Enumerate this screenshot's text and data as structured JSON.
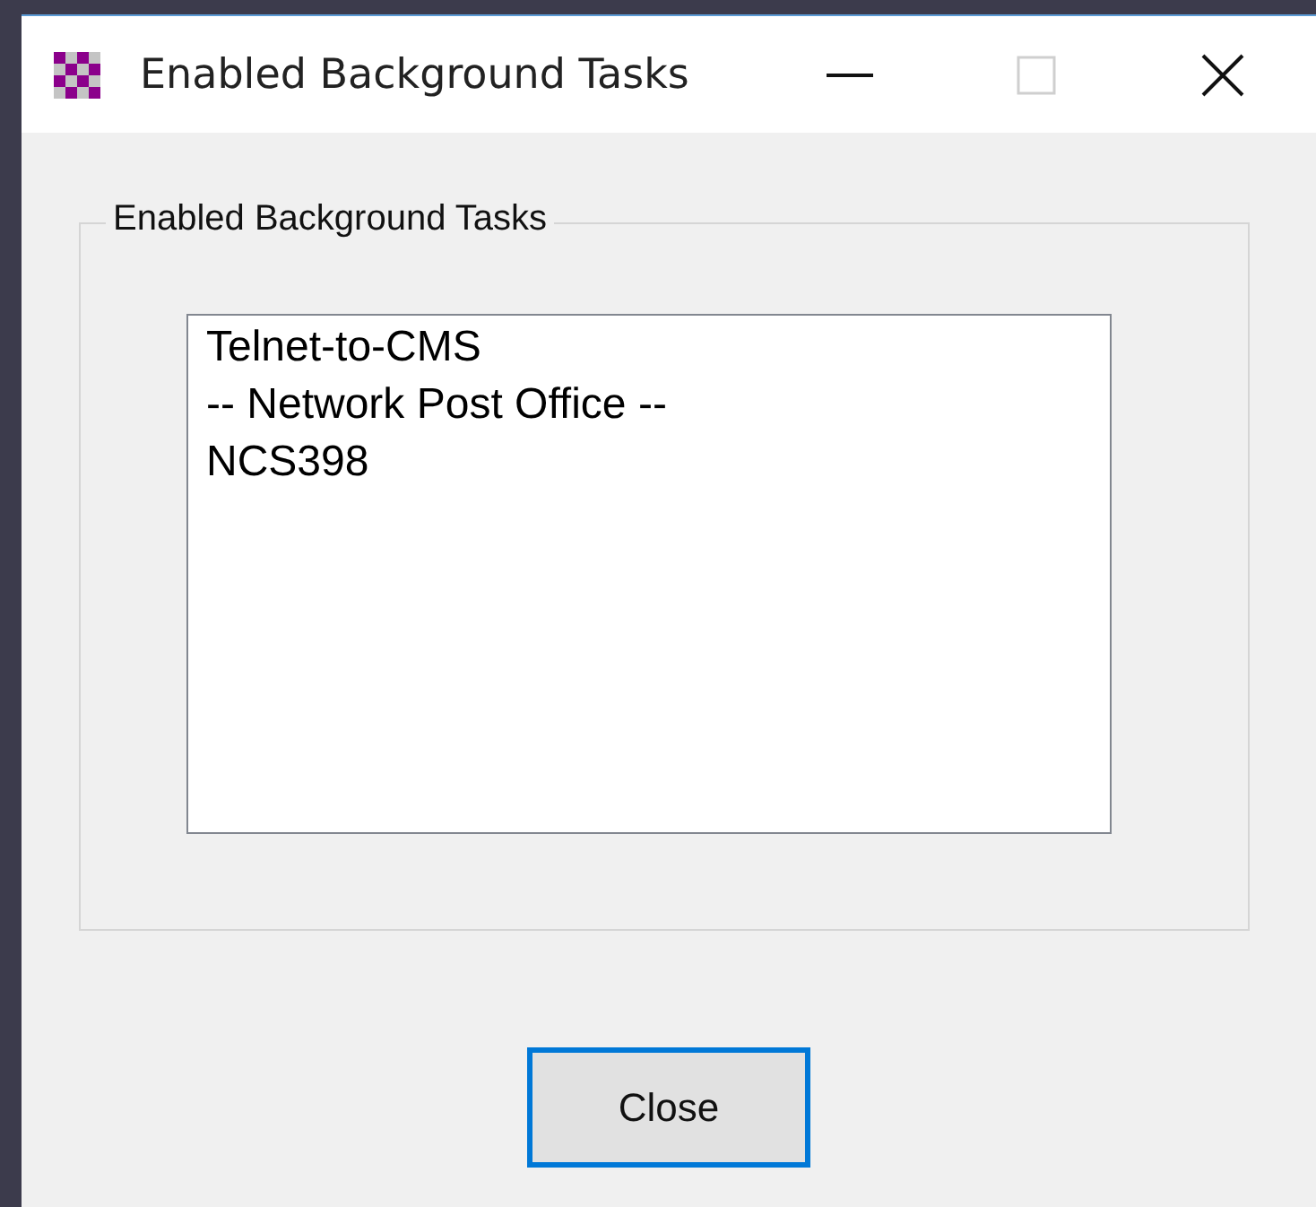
{
  "window": {
    "title": "Enabled Background Tasks",
    "maximize_disabled": true
  },
  "group": {
    "legend": "Enabled Background Tasks",
    "list_items": [
      {
        "text": "Telnet-to-CMS",
        "selected": false
      },
      {
        "text": "-- Network Post Office --",
        "selected": false
      },
      {
        "text": "NCS398",
        "selected": false
      }
    ]
  },
  "close_button": {
    "label": "Close",
    "focused": true
  }
}
